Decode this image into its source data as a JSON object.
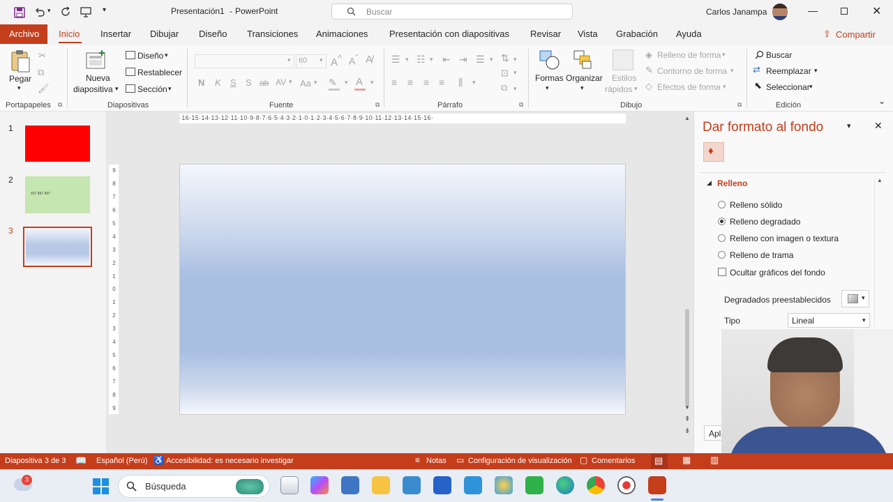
{
  "titlebar": {
    "document_title": "Presentación1",
    "separator": "-",
    "app_name": "PowerPoint",
    "search_placeholder": "Buscar",
    "user_name": "Carlos Janampa"
  },
  "menu_tabs": [
    "Archivo",
    "Inicio",
    "Insertar",
    "Dibujar",
    "Diseño",
    "Transiciones",
    "Animaciones",
    "Presentación con diapositivas",
    "Revisar",
    "Vista",
    "Grabación",
    "Ayuda"
  ],
  "share_label": "Compartir",
  "ribbon": {
    "clipboard": {
      "paste": "Pegar",
      "group": "Portapapeles"
    },
    "slides": {
      "new_slide_line1": "Nueva",
      "new_slide_line2": "diapositiva",
      "layout": "Diseño",
      "reset": "Restablecer",
      "section": "Sección",
      "group": "Diapositivas"
    },
    "font": {
      "size": "60",
      "bold": "N",
      "italic": "K",
      "underline": "S",
      "shadow": "S",
      "strike": "ab",
      "spacing": "AV",
      "case": "Aa",
      "group": "Fuente"
    },
    "paragraph": {
      "group": "Párrafo"
    },
    "drawing": {
      "shapes": "Formas",
      "arrange": "Organizar",
      "styles_line1": "Estilos",
      "styles_line2": "rápidos",
      "fill": "Relleno de forma",
      "outline": "Contorno de forma",
      "effects": "Efectos de forma",
      "group": "Dibujo"
    },
    "editing": {
      "find": "Buscar",
      "replace": "Reemplazar",
      "select": "Seleccionar",
      "group": "Edición"
    }
  },
  "ruler": {
    "horizontal": "·16·15·14·13·12·11·10·9·8·7·6·5·4·3·2·1·0·1·2·3·4·5·6·7·8·9·10·11·12·13·14·15·16·",
    "vertical": [
      "9",
      "8",
      "7",
      "6",
      "5",
      "4",
      "3",
      "2",
      "1",
      "0",
      "1",
      "2",
      "3",
      "4",
      "5",
      "6",
      "7",
      "8",
      "9"
    ]
  },
  "slides": [
    {
      "number": "1",
      "color": "#ff0000",
      "text": ""
    },
    {
      "number": "2",
      "color": "#c5e6b0",
      "text": "917 657 437"
    },
    {
      "number": "3",
      "color": "#b7c9e6",
      "text": ""
    }
  ],
  "format_panel": {
    "title": "Dar formato al fondo",
    "section": "Relleno",
    "options": [
      "Relleno sólido",
      "Relleno degradado",
      "Relleno con imagen o textura",
      "Relleno de trama"
    ],
    "selected_option": "Relleno degradado",
    "hide_graphics": "Ocultar gráficos del fondo",
    "presets_label": "Degradados preestablecidos",
    "type_label": "Tipo",
    "type_value": "Lineal",
    "apply_button": "Apl"
  },
  "statusbar": {
    "slide_info": "Diapositiva 3 de 3",
    "language": "Español (Perú)",
    "accessibility": "Accesibilidad: es necesario investigar",
    "notes": "Notas",
    "display_settings": "Configuración de visualización",
    "comments": "Comentarios"
  },
  "taskbar": {
    "search_label": "Búsqueda",
    "notification_count": "3"
  },
  "colors": {
    "accent": "#c43e1c",
    "slide_gradient_top": "#f4f7fc",
    "slide_gradient_mid": "#a9bfe2",
    "panel_title": "#c43e1c"
  }
}
